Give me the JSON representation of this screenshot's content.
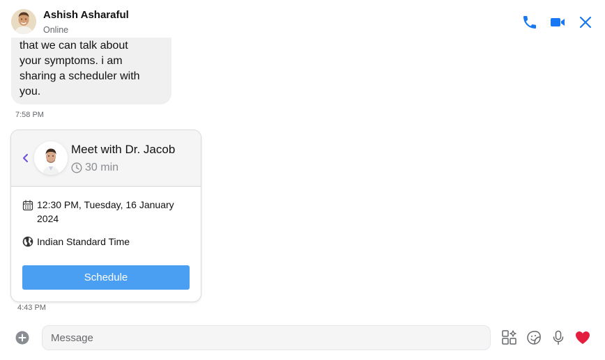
{
  "header": {
    "contact_name": "Ashish Asharaful",
    "status": "Online",
    "icons": [
      "phone-icon",
      "video-camera-icon",
      "close-icon"
    ]
  },
  "messages": [
    {
      "lines": [
        "that we can talk about",
        "your symptoms. i am",
        "sharing a scheduler with",
        "you."
      ],
      "time": "7:58 PM"
    }
  ],
  "scheduler": {
    "title": "Meet with Dr. Jacob",
    "duration": "30 min",
    "datetime_line1": "12:30 PM, Tuesday, 16 January",
    "datetime_line2": "2024",
    "timezone": "Indian Standard Time",
    "button_label": "Schedule",
    "time": "4:43 PM"
  },
  "composer": {
    "placeholder": "Message",
    "value": "",
    "icons": [
      "add-icon",
      "apps-icon",
      "sticker-icon",
      "microphone-icon",
      "heart-icon"
    ]
  },
  "colors": {
    "accent": "#1877f2",
    "button": "#4b9ff2",
    "heart": "#e41e3f",
    "bubble": "#f0f0f0"
  }
}
